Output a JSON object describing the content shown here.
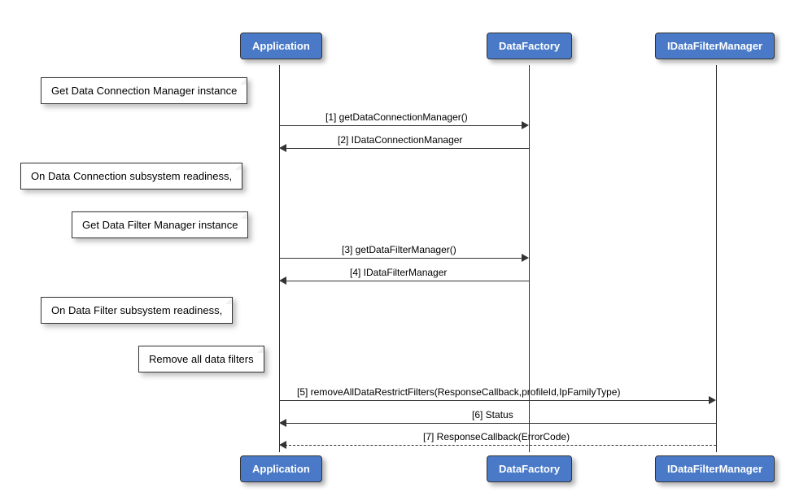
{
  "participants": {
    "app": "Application",
    "factory": "DataFactory",
    "filter": "IDataFilterManager"
  },
  "notes": {
    "n1": "Get Data Connection Manager instance",
    "n2": "On Data Connection subsystem readiness,",
    "n3": "Get Data Filter Manager instance",
    "n4": "On Data Filter subsystem readiness,",
    "n5": "Remove all data filters"
  },
  "messages": {
    "m1": "[1] getDataConnectionManager()",
    "m2": "[2] IDataConnectionManager",
    "m3": "[3] getDataFilterManager()",
    "m4": "[4] IDataFilterManager",
    "m5": "[5] removeAllDataRestrictFilters(ResponseCallback,profileId,IpFamilyType)",
    "m6": "[6] Status",
    "m7": "[7] ResponseCallback(ErrorCode)"
  }
}
